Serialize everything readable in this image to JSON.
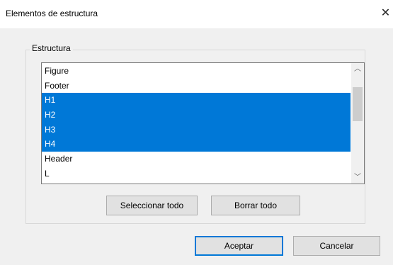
{
  "dialog": {
    "title": "Elementos de estructura",
    "close_glyph": "✕"
  },
  "group": {
    "legend": "Estructura",
    "items": [
      {
        "label": "Figure",
        "selected": false
      },
      {
        "label": "Footer",
        "selected": false
      },
      {
        "label": "H1",
        "selected": true
      },
      {
        "label": "H2",
        "selected": true
      },
      {
        "label": "H3",
        "selected": true
      },
      {
        "label": "H4",
        "selected": true
      },
      {
        "label": "Header",
        "selected": false
      },
      {
        "label": "L",
        "selected": false
      }
    ],
    "scroll_up_glyph": "︿",
    "scroll_down_glyph": "﹀"
  },
  "buttons": {
    "select_all": "Seleccionar todo",
    "clear_all": "Borrar todo",
    "accept": "Aceptar",
    "cancel": "Cancelar"
  },
  "colors": {
    "selection": "#0078d7",
    "dialog_bg": "#f0f0f0"
  }
}
